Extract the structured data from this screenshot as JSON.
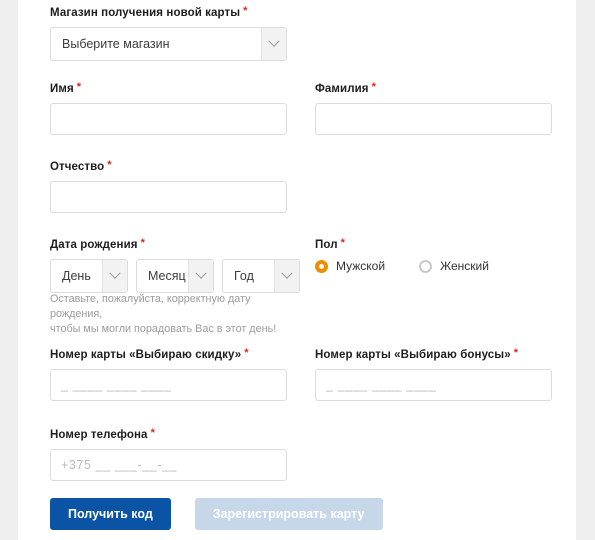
{
  "colors": {
    "accent_orange": "#f08c00",
    "primary_blue": "#0b54a5",
    "disabled_blue": "#c7d7ea",
    "required_red": "#e2231a",
    "page_bg": "#efefef",
    "card_bg": "#ffffff",
    "border": "#dcdcdc",
    "hint_text": "#9b9b9b"
  },
  "required_mark": "*",
  "store": {
    "label": "Магазин получения новой карты",
    "selected": "Выберите магазин"
  },
  "first_name": {
    "label": "Имя",
    "value": ""
  },
  "last_name": {
    "label": "Фамилия",
    "value": ""
  },
  "patronymic": {
    "label": "Отчество",
    "value": ""
  },
  "birth_date": {
    "label": "Дата рождения",
    "day": "День",
    "month": "Месяц",
    "year": "Год",
    "hint_line1": "Оставьте, пожалуйста, корректную дату рождения,",
    "hint_line2": "чтобы мы могли порадовать Вас в этот день!"
  },
  "gender": {
    "label": "Пол",
    "options": [
      {
        "label": "Мужской",
        "selected": true
      },
      {
        "label": "Женский",
        "selected": false
      }
    ]
  },
  "discount_card": {
    "label": "Номер карты «Выбираю скидку»",
    "placeholder": "_  ____  ____  ____",
    "value": ""
  },
  "bonus_card": {
    "label": "Номер карты «Выбираю бонусы»",
    "placeholder": "_  ____  ____  ____",
    "value": ""
  },
  "phone": {
    "label": "Номер телефона",
    "placeholder": "+375 __ ___-__-__",
    "value": ""
  },
  "buttons": {
    "get_code": "Получить код",
    "register_card": "Зарегистрировать карту"
  },
  "icons": {
    "chevron": "chevron-down-icon"
  }
}
